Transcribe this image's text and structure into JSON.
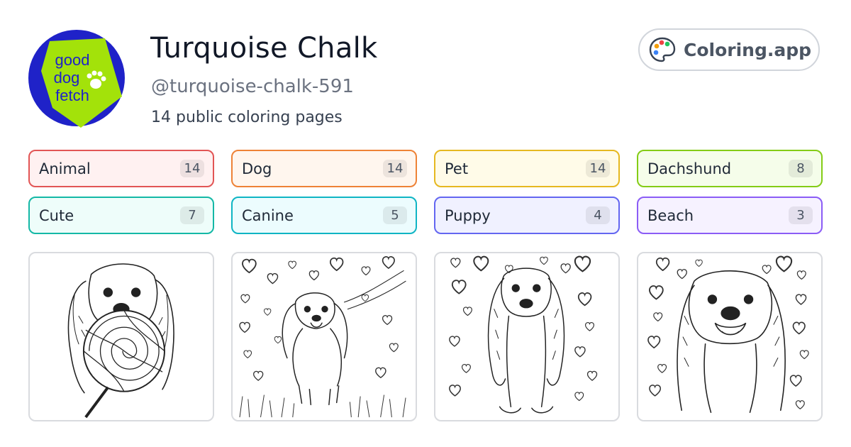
{
  "profile": {
    "name": "Turquoise Chalk",
    "handle": "@turquoise-chalk-591",
    "count": "14 public coloring pages",
    "avatar": {
      "line1": "good",
      "line2": "dog",
      "line3": "fetch",
      "icon": "paw-icon"
    }
  },
  "brand": {
    "label": "Coloring.app",
    "icon": "palette-icon"
  },
  "tags": [
    {
      "label": "Animal",
      "count": "14",
      "border": "#e25555",
      "bg": "#fff1f1"
    },
    {
      "label": "Dog",
      "count": "14",
      "border": "#ee8236",
      "bg": "#fff6ee"
    },
    {
      "label": "Pet",
      "count": "14",
      "border": "#e6b820",
      "bg": "#fffbe8"
    },
    {
      "label": "Dachshund",
      "count": "8",
      "border": "#84cc16",
      "bg": "#f5fdea"
    },
    {
      "label": "Cute",
      "count": "7",
      "border": "#14b8a6",
      "bg": "#eefdfa"
    },
    {
      "label": "Canine",
      "count": "5",
      "border": "#0fb5c4",
      "bg": "#ecfcfe"
    },
    {
      "label": "Puppy",
      "count": "4",
      "border": "#6366f1",
      "bg": "#f0f1ff"
    },
    {
      "label": "Beach",
      "count": "3",
      "border": "#8b5cf6",
      "bg": "#f6f2ff"
    }
  ],
  "colors": {
    "avatar_bg": "#1f22c8",
    "avatar_fg": "#a3e20a",
    "text": "#111827",
    "muted": "#6b7280"
  }
}
